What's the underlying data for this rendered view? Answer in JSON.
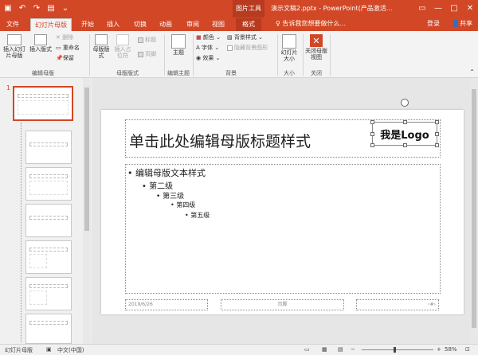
{
  "window": {
    "context_tab_group": "图片工具",
    "title": "演示文稿2.pptx - PowerPoint(产品激活...",
    "controls": [
      "—",
      "□",
      "✕"
    ]
  },
  "quick_access": {
    "save_icon": "save-icon",
    "undo_icon": "undo-icon",
    "redo_icon": "redo-icon",
    "start_icon": "start-icon"
  },
  "tabs": [
    "文件",
    "幻灯片母版",
    "开始",
    "插入",
    "切换",
    "动画",
    "审阅",
    "视图",
    "格式"
  ],
  "active_tab": "幻灯片母版",
  "tell_me": "告诉我您想要做什么...",
  "login": "登录",
  "share": "共享",
  "ribbon": {
    "edit_master": {
      "label": "编辑母版",
      "insert_master": "插入幻灯片母版",
      "insert_layout": "插入版式",
      "delete": "删除",
      "rename": "重命名",
      "preserve": "保留"
    },
    "master_layout": {
      "label": "母版版式",
      "layout": "母版版式",
      "placeholder": "插入占位符",
      "title_check": "标题",
      "footer_check": "页脚"
    },
    "edit_theme": {
      "label": "编辑主题",
      "theme": "主题"
    },
    "background": {
      "label": "背景",
      "colors": "颜色",
      "fonts": "字体",
      "effects": "效果",
      "bg_styles": "背景样式",
      "hide_bg": "隐藏背景图形"
    },
    "size": {
      "label": "大小",
      "slide_size": "幻灯片大小"
    },
    "close": {
      "label": "关闭",
      "close_master": "关闭母版视图"
    }
  },
  "thumbnails": {
    "first_number": "1"
  },
  "slide": {
    "title": "单击此处编辑母版标题样式",
    "logo": "我是Logo",
    "levels": [
      "• 编辑母版文本样式",
      "• 第二级",
      "• 第三级",
      "• 第四级",
      "• 第五级"
    ],
    "footer_date": "2019/6/26",
    "footer_center": "页脚",
    "footer_number": "‹#›"
  },
  "status": {
    "view": "幻灯片母版",
    "language": "中文(中国)",
    "zoom": "58%",
    "zoom_minus": "−",
    "zoom_plus": "+"
  }
}
